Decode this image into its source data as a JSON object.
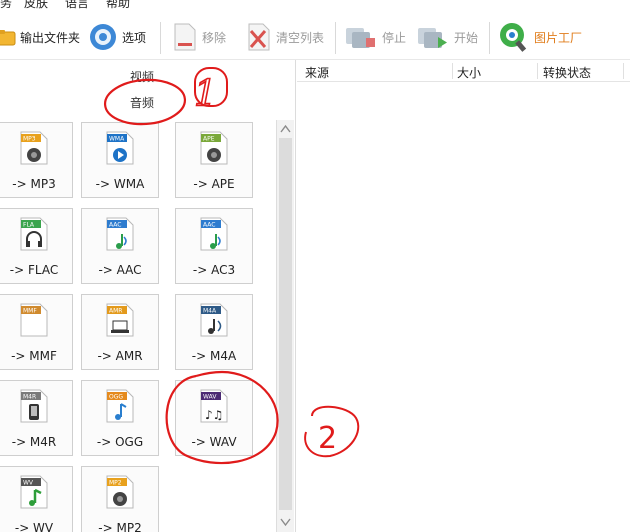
{
  "menu": [
    "务",
    "皮肤",
    "语言",
    "帮助"
  ],
  "toolbar": {
    "output_folder": "输出文件夹",
    "options": "选项",
    "remove": "移除",
    "clear_list": "清空列表",
    "stop": "停止",
    "start": "开始",
    "image_factory": "图片工厂"
  },
  "categories": {
    "video": "视频",
    "audio": "音频"
  },
  "tiles": [
    {
      "badge": "MP3",
      "label": "-> MP3",
      "color": "#e8a11d",
      "glyph": "speaker"
    },
    {
      "badge": "WMA",
      "label": "-> WMA",
      "color": "#1e73c7",
      "glyph": "play"
    },
    {
      "badge": "APE",
      "label": "-> APE",
      "color": "#7aa83a",
      "glyph": "speaker"
    },
    {
      "badge": "FLA",
      "label": "-> FLAC",
      "color": "#3aa44d",
      "glyph": "headphones"
    },
    {
      "badge": "AAC",
      "label": "-> AAC",
      "color": "#2e7ccf",
      "glyph": "note"
    },
    {
      "badge": "AAC",
      "label": "-> AC3",
      "color": "#2e7ccf",
      "glyph": "note"
    },
    {
      "badge": "MMF",
      "label": "-> MMF",
      "color": "#d08a2e",
      "glyph": "none"
    },
    {
      "badge": "AMR",
      "label": "-> AMR",
      "color": "#e39a1c",
      "glyph": "laptop"
    },
    {
      "badge": "M4A",
      "label": "-> M4A",
      "color": "#2e5a87",
      "glyph": "music"
    },
    {
      "badge": "M4R",
      "label": "-> M4R",
      "color": "#7a7a7a",
      "glyph": "phone"
    },
    {
      "badge": "OGG",
      "label": "-> OGG",
      "color": "#e58a1d",
      "glyph": "note-blue"
    },
    {
      "badge": "WAV",
      "label": "-> WAV",
      "color": "#4b2a73",
      "glyph": "notes"
    },
    {
      "badge": "WV",
      "label": "-> WV",
      "color": "#555555",
      "glyph": "note-green"
    },
    {
      "badge": "MP2",
      "label": "-> MP2",
      "color": "#e8a11d",
      "glyph": "speaker"
    }
  ],
  "file_list": {
    "columns": [
      "来源",
      "大小",
      "转换状态"
    ]
  },
  "annotations": {
    "one": "1",
    "two": "2"
  }
}
